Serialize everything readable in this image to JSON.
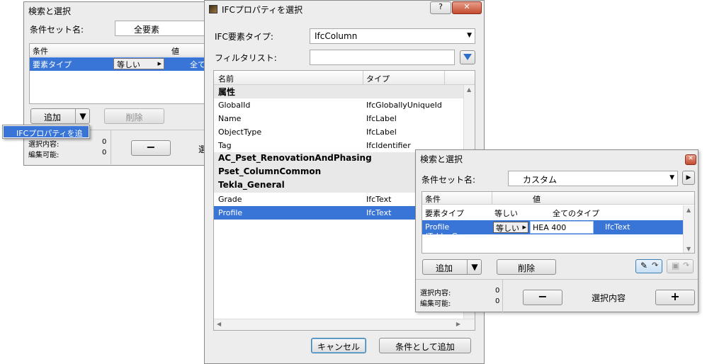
{
  "win1": {
    "title": "検索と選択",
    "condset_label": "条件セット名:",
    "condset_value": "全要素",
    "cols": [
      "条件",
      "値"
    ],
    "row": {
      "cond": "要素タイプ",
      "op": "等しい",
      "val": "全て"
    },
    "add_label": "追加",
    "delete_label": "削除",
    "popup_item": "IFCプロパティを追加",
    "stat1_label": "選択内容:",
    "stat1_val": "0",
    "stat2_label": "編集可能:",
    "stat2_val": "0",
    "minus": "−",
    "right_text": "選"
  },
  "win2": {
    "title": "IFCプロパティを選択",
    "help": "?",
    "close": "✕",
    "type_label": "IFC要素タイプ:",
    "type_value": "IfcColumn",
    "filter_label": "フィルタリスト:",
    "cols": [
      "名前",
      "タイプ"
    ],
    "groups": [
      {
        "name": "属性",
        "rows": [
          {
            "name": "GlobalId",
            "type": "IfcGloballyUniqueId"
          },
          {
            "name": "Name",
            "type": "IfcLabel"
          },
          {
            "name": "ObjectType",
            "type": "IfcLabel"
          },
          {
            "name": "Tag",
            "type": "IfcIdentifier"
          }
        ]
      },
      {
        "name": "AC_Pset_RenovationAndPhasing",
        "rows": []
      },
      {
        "name": "Pset_ColumnCommon",
        "rows": []
      },
      {
        "name": "Tekla_General",
        "rows": [
          {
            "name": "Grade",
            "type": "IfcText"
          },
          {
            "name": "Profile",
            "type": "IfcText"
          }
        ]
      }
    ],
    "cancel_label": "キャンセル",
    "add_cond_label": "条件として追加"
  },
  "win3": {
    "title": "検索と選択",
    "close": "✕",
    "condset_label": "条件セット名:",
    "condset_value": "カスタム",
    "cols": [
      "条件",
      "値"
    ],
    "rows": [
      {
        "cond": "要素タイプ",
        "op": "等しい",
        "val": "全てのタイプ",
        "type": ""
      },
      {
        "cond": "Profile (Tekla_G...",
        "op": "等しい",
        "val": "HEA 400",
        "type": "IfcText"
      }
    ],
    "add_label": "追加",
    "delete_label": "削除",
    "stat1_label": "選択内容:",
    "stat1_val": "0",
    "stat2_label": "編集可能:",
    "stat2_val": "0",
    "minus": "−",
    "plus": "+",
    "sel_label": "選択内容"
  }
}
